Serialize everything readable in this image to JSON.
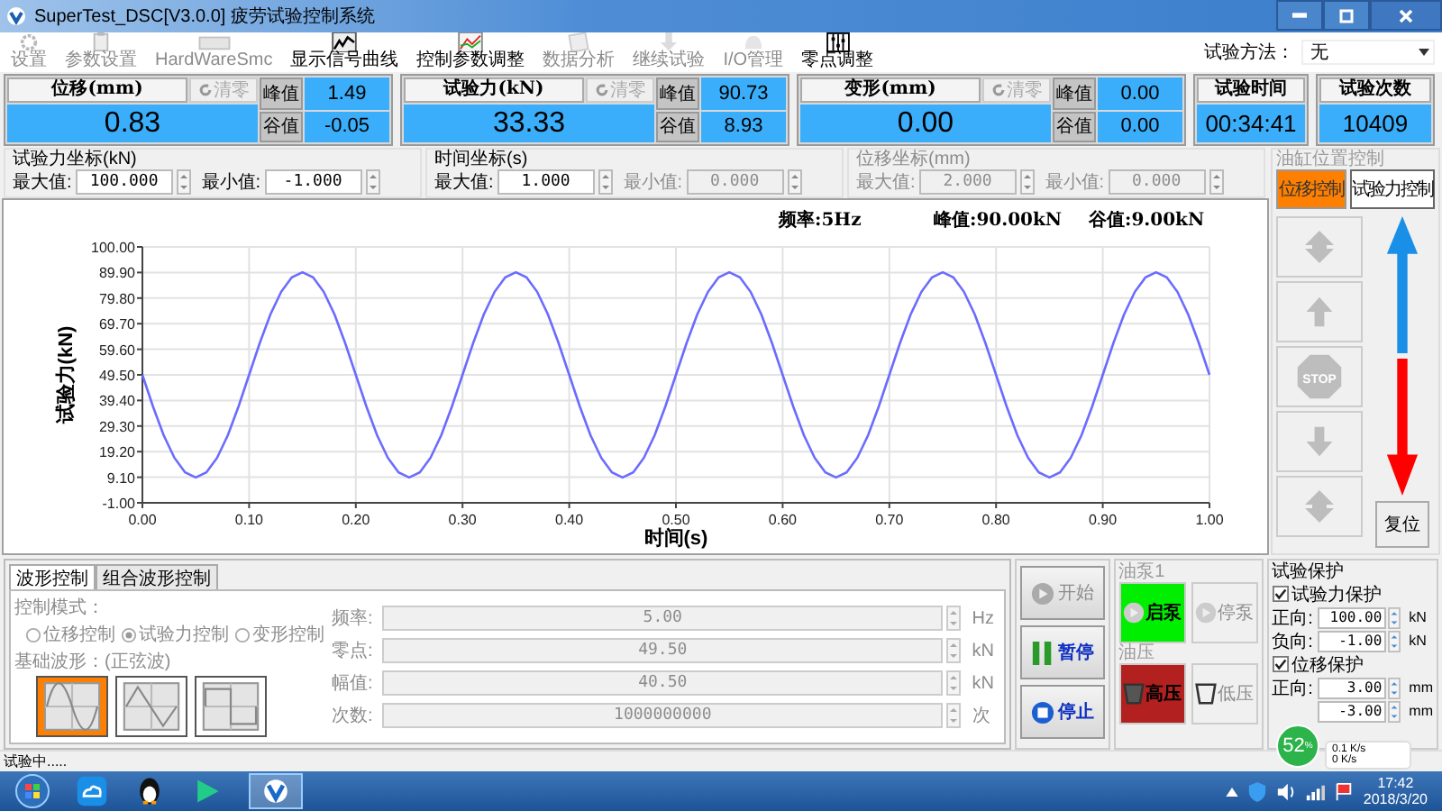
{
  "window": {
    "title": "SuperTest_DSC[V3.0.0] 疲劳试验控制系统"
  },
  "toolbar": [
    {
      "label": "设置",
      "disabled": true
    },
    {
      "label": "参数设置",
      "disabled": true
    },
    {
      "label": "HardWareSmc",
      "disabled": true
    },
    {
      "label": "显示信号曲线",
      "disabled": false
    },
    {
      "label": "控制参数调整",
      "disabled": false
    },
    {
      "label": "数据分析",
      "disabled": true
    },
    {
      "label": "继续试验",
      "disabled": true
    },
    {
      "label": "I/O管理",
      "disabled": true
    },
    {
      "label": "零点调整",
      "disabled": false
    }
  ],
  "test_method": {
    "label": "试验方法：",
    "value": "无"
  },
  "readouts": [
    {
      "title": "位移(mm)",
      "clear": "清零",
      "value": "0.83",
      "peak_label": "峰值",
      "peak": "1.49",
      "valley_label": "谷值",
      "valley": "-0.05"
    },
    {
      "title": "试验力(kN)",
      "clear": "清零",
      "value": "33.33",
      "peak_label": "峰值",
      "peak": "90.73",
      "valley_label": "谷值",
      "valley": "8.93"
    },
    {
      "title": "变形(mm)",
      "clear": "清零",
      "value": "0.00",
      "peak_label": "峰值",
      "peak": "0.00",
      "valley_label": "谷值",
      "valley": "0.00"
    }
  ],
  "counters": [
    {
      "title": "试验时间",
      "value": "00:34:41"
    },
    {
      "title": "试验次数",
      "value": "10409"
    }
  ],
  "axes": [
    {
      "title": "试验力坐标(kN)",
      "disabled": false,
      "fields": [
        {
          "label": "最大值:",
          "value": "100.000",
          "disabled": false
        },
        {
          "label": "最小值:",
          "value": "-1.000",
          "disabled": false
        }
      ]
    },
    {
      "title": "时间坐标(s)",
      "disabled": false,
      "fields": [
        {
          "label": "最大值:",
          "value": "1.000",
          "disabled": false
        },
        {
          "label": "最小值:",
          "value": "0.000",
          "disabled": true
        }
      ]
    },
    {
      "title": "位移坐标(mm)",
      "disabled": true,
      "fields": [
        {
          "label": "最大值:",
          "value": "2.000",
          "disabled": true
        },
        {
          "label": "最小值:",
          "value": "0.000",
          "disabled": true
        }
      ]
    }
  ],
  "chart": {
    "info": [
      "频率:5Hz",
      "峰值:90.00kN",
      "谷值:9.00kN"
    ],
    "chart_data": {
      "type": "line",
      "grid": true,
      "xlabel": "时间(s)",
      "ylabel": "试验力(kN)",
      "xlim": [
        0,
        1
      ],
      "ylim": [
        -1,
        100
      ],
      "xticks": [
        {
          "value": 0,
          "label": "0.00"
        },
        {
          "value": 0.1,
          "label": "0.10"
        },
        {
          "value": 0.2,
          "label": "0.20"
        },
        {
          "value": 0.3,
          "label": "0.30"
        },
        {
          "value": 0.4,
          "label": "0.40"
        },
        {
          "value": 0.5,
          "label": "0.50"
        },
        {
          "value": 0.6,
          "label": "0.60"
        },
        {
          "value": 0.7,
          "label": "0.70"
        },
        {
          "value": 0.8,
          "label": "0.80"
        },
        {
          "value": 0.9,
          "label": "0.90"
        },
        {
          "value": 1,
          "label": "1.00"
        }
      ],
      "yticks": [
        {
          "value": -1,
          "label": "-1.00"
        },
        {
          "value": 9.1,
          "label": "9.10"
        },
        {
          "value": 19.2,
          "label": "19.20"
        },
        {
          "value": 29.3,
          "label": "29.30"
        },
        {
          "value": 39.4,
          "label": "39.40"
        },
        {
          "value": 49.5,
          "label": "49.50"
        },
        {
          "value": 59.6,
          "label": "59.60"
        },
        {
          "value": 69.7,
          "label": "69.70"
        },
        {
          "value": 79.8,
          "label": "79.80"
        },
        {
          "value": 89.9,
          "label": "89.90"
        },
        {
          "value": 100,
          "label": "100.00"
        }
      ],
      "x": [
        0,
        0.01,
        0.02,
        0.03,
        0.04,
        0.05,
        0.06,
        0.07,
        0.08,
        0.09,
        0.1,
        0.11,
        0.12,
        0.13,
        0.14,
        0.15,
        0.16,
        0.17,
        0.18,
        0.19,
        0.2,
        0.21,
        0.22,
        0.23,
        0.24,
        0.25,
        0.26,
        0.27,
        0.28,
        0.29,
        0.3,
        0.31,
        0.32,
        0.33,
        0.34,
        0.35,
        0.36,
        0.37,
        0.38,
        0.39,
        0.4,
        0.41,
        0.42,
        0.43,
        0.44,
        0.45,
        0.46,
        0.47,
        0.48,
        0.49,
        0.5,
        0.51,
        0.52,
        0.53,
        0.54,
        0.55,
        0.56,
        0.57,
        0.58,
        0.59,
        0.6,
        0.61,
        0.62,
        0.63,
        0.64,
        0.65,
        0.66,
        0.67,
        0.68,
        0.69,
        0.7,
        0.71,
        0.72,
        0.73,
        0.74,
        0.75,
        0.76,
        0.77,
        0.78,
        0.79,
        0.8,
        0.81,
        0.82,
        0.83,
        0.84,
        0.85,
        0.86,
        0.87,
        0.88,
        0.89,
        0.9,
        0.91,
        0.92,
        0.93,
        0.94,
        0.95,
        0.96,
        0.97,
        0.98,
        0.99,
        1
      ],
      "series": [
        {
          "color": "#6b6bff",
          "values": [
            49.5,
            37,
            25.7,
            16.7,
            11,
            9,
            11,
            16.7,
            25.7,
            37,
            49.5,
            62,
            73.3,
            82.3,
            88,
            90,
            88,
            82.3,
            73.3,
            62,
            49.5,
            37,
            25.7,
            16.7,
            11,
            9,
            11,
            16.7,
            25.7,
            37,
            49.5,
            62,
            73.3,
            82.3,
            88,
            90,
            88,
            82.3,
            73.3,
            62,
            49.5,
            37,
            25.7,
            16.7,
            11,
            9,
            11,
            16.7,
            25.7,
            37,
            49.5,
            62,
            73.3,
            82.3,
            88,
            90,
            88,
            82.3,
            73.3,
            62,
            49.5,
            37,
            25.7,
            16.7,
            11,
            9,
            11,
            16.7,
            25.7,
            37,
            49.5,
            62,
            73.3,
            82.3,
            88,
            90,
            88,
            82.3,
            73.3,
            62,
            49.5,
            37,
            25.7,
            16.7,
            11,
            9,
            11,
            16.7,
            25.7,
            37,
            49.5,
            62,
            73.3,
            82.3,
            88,
            90,
            88,
            82.3,
            73.3,
            62,
            49.5
          ]
        }
      ]
    }
  },
  "position_control": {
    "title": "油缸位置控制",
    "modes": [
      {
        "label": "位移控制",
        "selected": true
      },
      {
        "label": "试验力控制",
        "selected": false
      }
    ],
    "jog_buttons": [
      {
        "kind": "fast-up",
        "disabled": true
      },
      {
        "kind": "up",
        "disabled": true
      },
      {
        "kind": "stop",
        "label": "STOP",
        "disabled": true
      },
      {
        "kind": "down",
        "disabled": true
      },
      {
        "kind": "fast-down",
        "disabled": true
      }
    ],
    "reset": "复位"
  },
  "wave_panel": {
    "disabled": true,
    "tabs": [
      {
        "label": "波形控制",
        "selected": true
      },
      {
        "label": "组合波形控制",
        "selected": false
      }
    ],
    "mode_label": "控制模式：",
    "modes": [
      {
        "label": "位移控制",
        "selected": false
      },
      {
        "label": "试验力控制",
        "selected": true
      },
      {
        "label": "变形控制",
        "selected": false
      }
    ],
    "wave_label": "基础波形：(正弦波)",
    "waves": [
      {
        "kind": "sine",
        "selected": true
      },
      {
        "kind": "triangle",
        "selected": false
      },
      {
        "kind": "square",
        "selected": false
      }
    ],
    "params": [
      {
        "label": "频率:",
        "value": "5.00",
        "unit": "Hz"
      },
      {
        "label": "零点:",
        "value": "49.50",
        "unit": "kN"
      },
      {
        "label": "幅值:",
        "value": "40.50",
        "unit": "kN"
      },
      {
        "label": "次数:",
        "value": "1000000000",
        "unit": "次"
      }
    ]
  },
  "run_buttons": [
    {
      "kind": "start",
      "label": "开始",
      "disabled": true
    },
    {
      "kind": "pause",
      "label": "暂停",
      "disabled": false
    },
    {
      "kind": "stop",
      "label": "停止",
      "disabled": false
    }
  ],
  "pump": {
    "title": "油泵1",
    "buttons": [
      {
        "label": "启泵",
        "on": true
      },
      {
        "label": "停泵",
        "on": false
      }
    ]
  },
  "pressure": {
    "title": "油压",
    "buttons": [
      {
        "label": "高压",
        "on": true
      },
      {
        "label": "低压",
        "on": false
      }
    ]
  },
  "protection": {
    "title": "试验保护",
    "groups": [
      {
        "label": "试验力保护",
        "checked": true,
        "fields": [
          {
            "label": "正向:",
            "value": "100.00",
            "unit": "kN"
          },
          {
            "label": "负向:",
            "value": "-1.00",
            "unit": "kN"
          }
        ]
      },
      {
        "label": "位移保护",
        "checked": true,
        "fields": [
          {
            "label": "正向:",
            "value": "3.00",
            "unit": "mm"
          },
          {
            "value": "-3.00",
            "unit": "mm"
          }
        ]
      }
    ]
  },
  "speed_widget": {
    "percent": "52",
    "unit": "%",
    "up": "0.1 K/s",
    "down": "0 K/s"
  },
  "status_bar": "试验中.....",
  "taskbar": {
    "time": "17:42",
    "date": "2018/3/20"
  }
}
